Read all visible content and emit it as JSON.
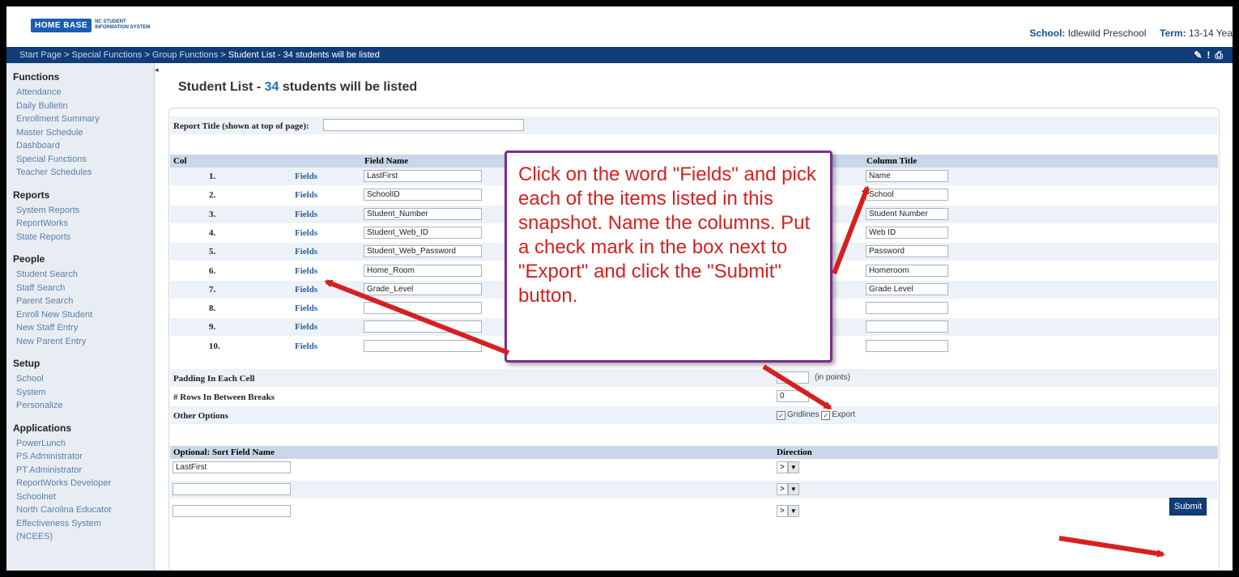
{
  "header": {
    "logo_text": "HOME BASE",
    "logo_sub": "NC STUDENT INFORMATION SYSTEM",
    "school_label": "School:",
    "school_value": "Idlewild Preschool",
    "term_label": "Term:",
    "term_value": "13-14 Yea"
  },
  "breadcrumb": {
    "items": [
      "Start Page",
      "Special Functions",
      "Group Functions"
    ],
    "current": "Student List - 34 students will be listed",
    "sep": " > "
  },
  "sidebar": {
    "sections": [
      {
        "title": "Functions",
        "items": [
          "Attendance",
          "Daily Bulletin",
          "Enrollment Summary",
          "Master Schedule",
          "Dashboard",
          "Special Functions",
          "Teacher Schedules"
        ]
      },
      {
        "title": "Reports",
        "items": [
          "System Reports",
          "ReportWorks",
          "State Reports"
        ]
      },
      {
        "title": "People",
        "items": [
          "Student Search",
          "Staff Search",
          "Parent Search",
          "Enroll New Student",
          "New Staff Entry",
          "New Parent Entry"
        ]
      },
      {
        "title": "Setup",
        "items": [
          "School",
          "System",
          "Personalize"
        ]
      },
      {
        "title": "Applications",
        "items": [
          "PowerLunch",
          "PS Administrator",
          "PT Administrator",
          "ReportWorks Developer",
          "Schoolnet",
          "North Carolina Educator",
          "Effectiveness System",
          "(NCEES)"
        ]
      }
    ]
  },
  "page": {
    "title_prefix": "Student List - ",
    "count": "34",
    "title_suffix": " students will be listed",
    "report_title_label": "Report Title (shown at top of page):",
    "report_title_value": "",
    "col_header": "Col",
    "field_name_header": "Field Name",
    "column_title_header": "Column Title",
    "fields_link": "Fields",
    "rows": [
      {
        "num": "1.",
        "field": "LastFirst",
        "title": "Name"
      },
      {
        "num": "2.",
        "field": "SchoolID",
        "title": "School"
      },
      {
        "num": "3.",
        "field": "Student_Number",
        "title": "Student Number"
      },
      {
        "num": "4.",
        "field": "Student_Web_ID",
        "title": "Web ID"
      },
      {
        "num": "5.",
        "field": "Student_Web_Password",
        "title": "Password"
      },
      {
        "num": "6.",
        "field": "Home_Room",
        "title": "Homeroom"
      },
      {
        "num": "7.",
        "field": "Grade_Level",
        "title": "Grade Level"
      },
      {
        "num": "8.",
        "field": "",
        "title": ""
      },
      {
        "num": "9.",
        "field": "",
        "title": ""
      },
      {
        "num": "10.",
        "field": "",
        "title": ""
      }
    ],
    "padding_label": "Padding In Each Cell",
    "padding_value": "",
    "padding_unit": "(in points)",
    "rows_between_label": "# Rows In Between Breaks",
    "rows_between_value": "0",
    "other_options_label": "Other Options",
    "gridlines_label": "Gridlines",
    "export_label": "Export",
    "check_mark": "✓",
    "sort_header": "Optional: Sort Field Name",
    "direction_header": "Direction",
    "sort_rows": [
      {
        "field": "LastFirst",
        "dir": ">"
      },
      {
        "field": "",
        "dir": ">"
      },
      {
        "field": "",
        "dir": ">"
      }
    ],
    "dropdown_glyph": "▼",
    "submit_label": "Submit"
  },
  "callout": {
    "text": "Click on the word \"Fields\" and pick each of the items listed in this snapshot.  Name the columns.  Put a check mark in the box next to \"Export\" and click the \"Submit\" button."
  },
  "colors": {
    "topbar": "#103d7a",
    "arrow": "#d62020",
    "callout_border": "#7b2d8e",
    "link": "#2a5f9e"
  }
}
